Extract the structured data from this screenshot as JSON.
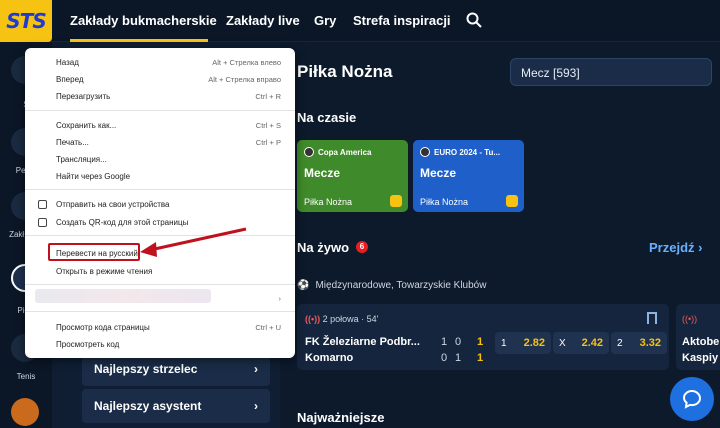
{
  "topnav": {
    "logo": "STS",
    "items": [
      "Zakłady bukmacherskie",
      "Zakłady live",
      "Gry",
      "Strefa inspiracji"
    ]
  },
  "rail": {
    "items": [
      "S",
      "Pełna",
      "Zakł. Spe",
      "Piłka",
      "Tenis"
    ]
  },
  "main": {
    "title": "Piłka Nożna",
    "select_value": "Mecz [593]",
    "na_czasie": "Na czasie",
    "promos": [
      {
        "tag": "Copa America",
        "big": "Mecze",
        "sub": "Piłka Nożna"
      },
      {
        "tag": "EURO 2024 - Tu...",
        "big": "Mecze",
        "sub": "Piłka Nożna"
      }
    ],
    "na_zywo": "Na żywo",
    "live_count": "6",
    "przejdz": "Przejdź",
    "league": "Międzynarodowe, Towarzyskie Klubów",
    "match": {
      "status": "2 połowa · 54'",
      "team1": "FK Železiarne Podbr...",
      "team2": "Komarno",
      "score1": [
        "1",
        "0",
        "1"
      ],
      "score2": [
        "0",
        "1",
        "1"
      ],
      "odds": [
        {
          "label": "1",
          "value": "2.82"
        },
        {
          "label": "X",
          "value": "2.42"
        },
        {
          "label": "2",
          "value": "3.32"
        }
      ]
    },
    "side_card": {
      "team1": "Aktobe",
      "team2": "Kaspiy"
    },
    "najwazniejsze": "Najważniejsze"
  },
  "left_panel": {
    "rows": [
      "Najlepszy strzelec",
      "Najlepszy asystent"
    ]
  },
  "context_menu": {
    "items": [
      {
        "label": "Назад",
        "key": "Alt + Стрелка влево"
      },
      {
        "label": "Вперед",
        "key": "Alt + Стрелка вправо"
      },
      {
        "label": "Перезагрузить",
        "key": "Ctrl + R"
      },
      {
        "label": "Сохранить как...",
        "key": "Ctrl + S"
      },
      {
        "label": "Печать...",
        "key": "Ctrl + P"
      },
      {
        "label": "Трансляция...",
        "key": ""
      },
      {
        "label": "Найти через Google",
        "key": ""
      },
      {
        "label": "Отправить на свои устройства",
        "key": ""
      },
      {
        "label": "Создать QR-код для этой страницы",
        "key": ""
      },
      {
        "label": "Перевести на русский",
        "key": ""
      },
      {
        "label": "Открыть в режиме чтения",
        "key": ""
      },
      {
        "label": "Просмотр кода страницы",
        "key": "Ctrl + U"
      },
      {
        "label": "Просмотреть код",
        "key": ""
      }
    ]
  },
  "colors": {
    "accent": "#f6c313",
    "highlight": "#c0121e",
    "link": "#6ab0ff"
  }
}
